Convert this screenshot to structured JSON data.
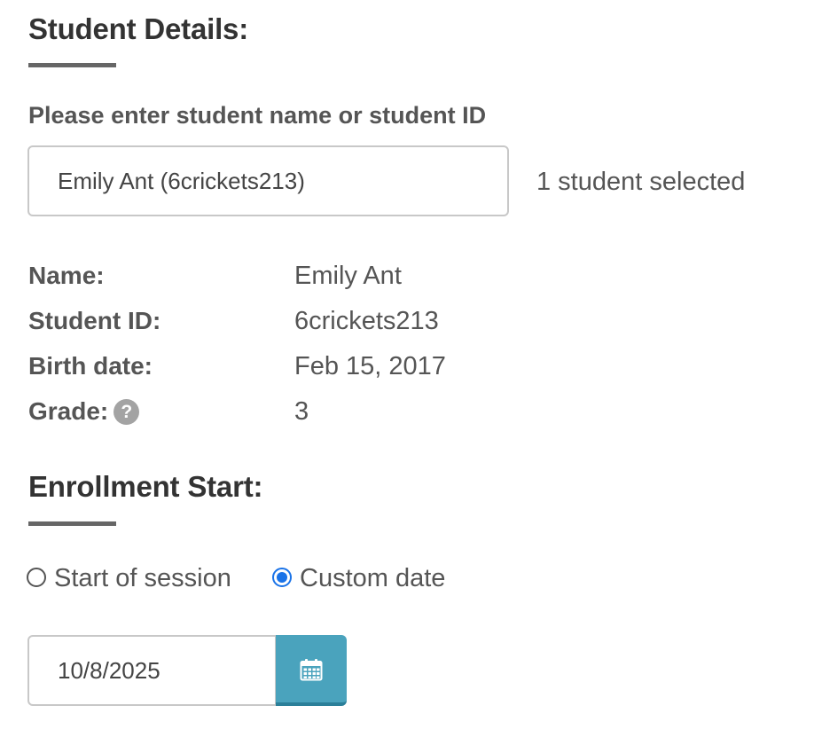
{
  "student_details": {
    "title": "Student Details:",
    "prompt": "Please enter student name or student ID",
    "search_value": "Emily Ant (6crickets213)",
    "selected_count": "1 student selected",
    "rows": [
      {
        "label": "Name:",
        "value": "Emily Ant"
      },
      {
        "label": "Student ID:",
        "value": "6crickets213"
      },
      {
        "label": "Birth date:",
        "value": "Feb 15, 2017"
      },
      {
        "label": "Grade:",
        "value": "3",
        "icon": "help-icon"
      }
    ]
  },
  "enrollment_start": {
    "title": "Enrollment Start:",
    "options": [
      {
        "label": "Start of session",
        "checked": false
      },
      {
        "label": "Custom date",
        "checked": true
      }
    ],
    "date_value": "10/8/2025",
    "calendar_icon": "calendar-icon"
  },
  "colors": {
    "accent_radio": "#1a73e8",
    "calendar_button": "#4aa3bd",
    "underline": "#666666"
  }
}
